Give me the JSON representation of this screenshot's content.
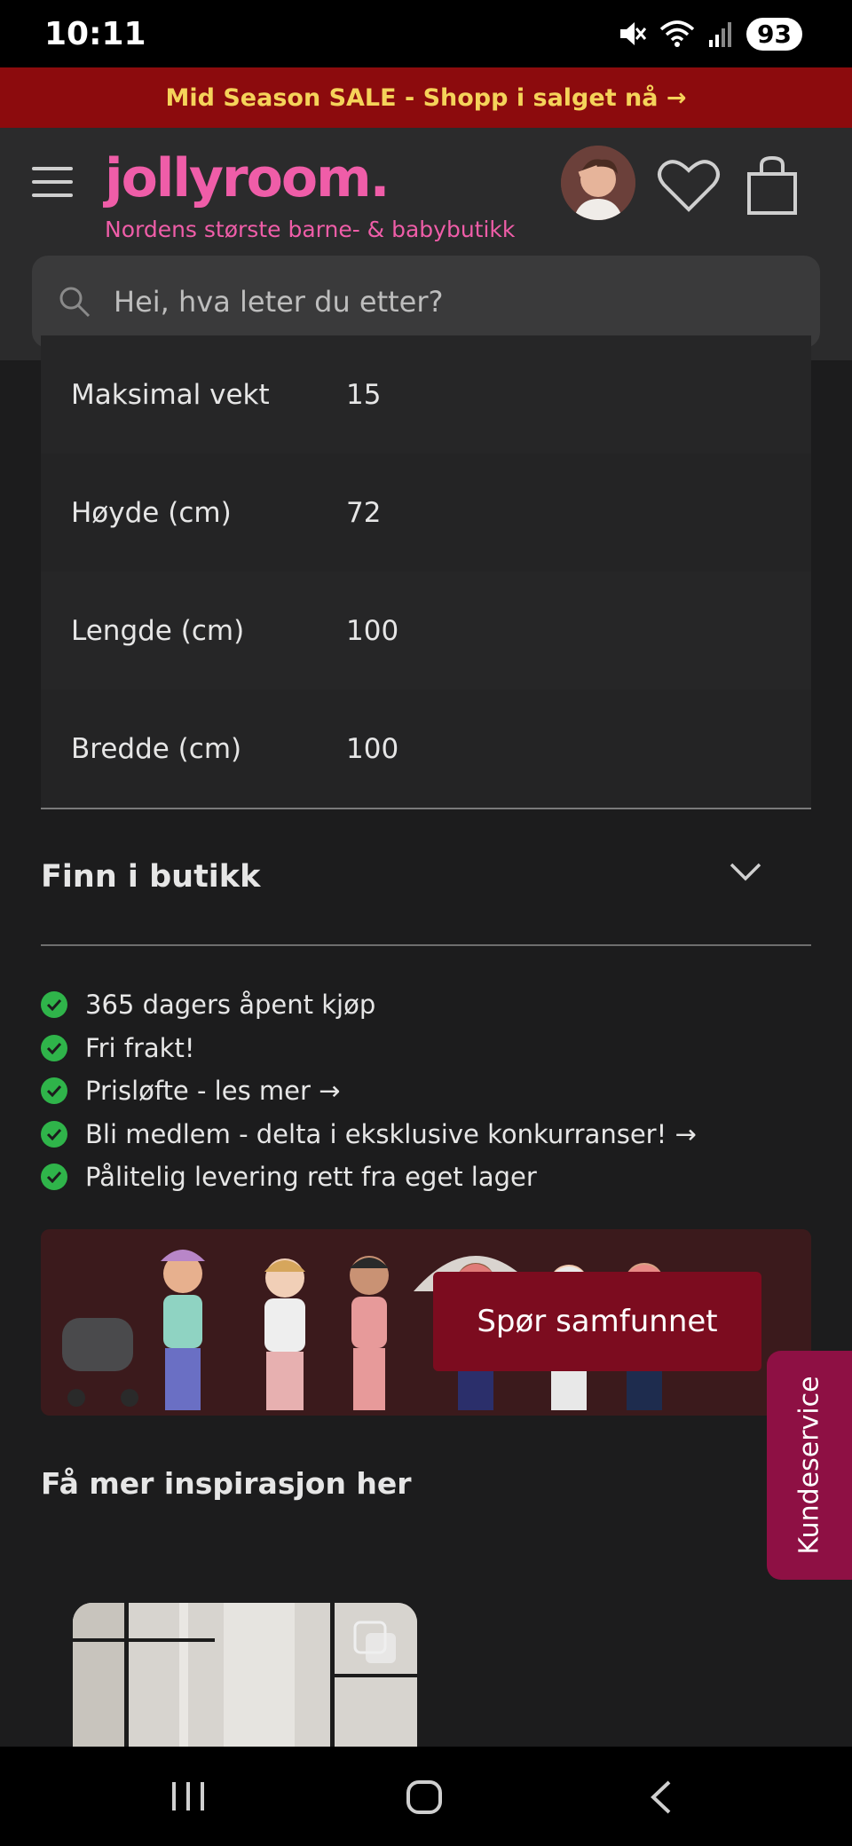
{
  "status_bar": {
    "time": "10:11",
    "battery": "93",
    "icons": [
      "mute-icon",
      "wifi-icon",
      "signal-icon"
    ]
  },
  "promo": {
    "text": "Mid Season SALE - Shopp i salget nå →",
    "background": "#8c0b0d",
    "text_color": "#f5d35a"
  },
  "header": {
    "logo": "jollyroom.",
    "tagline": "Nordens største barne- & babybutikk",
    "brand_color": "#ef5da8",
    "icons": [
      "menu-icon",
      "avatar",
      "heart-icon",
      "bag-icon"
    ]
  },
  "search": {
    "placeholder": "Hei, hva leter du etter?"
  },
  "specs": [
    {
      "label": "Maksimal vekt",
      "value": "15"
    },
    {
      "label": "Høyde (cm)",
      "value": "72"
    },
    {
      "label": "Lengde (cm)",
      "value": "100"
    },
    {
      "label": "Bredde (cm)",
      "value": "100"
    }
  ],
  "accordion": {
    "title": "Finn i butikk"
  },
  "usps": [
    "365 dagers åpent kjøp",
    "Fri frakt!",
    "Prisløfte - les mer →",
    "Bli medlem - delta i eksklusive konkurranser! →",
    "Pålitelig levering rett fra eget lager"
  ],
  "community": {
    "button_label": "Spør samfunnet",
    "button_color": "#7c0c1f"
  },
  "kundeservice": {
    "label": "Kundeservice",
    "color": "#8e1044"
  },
  "inspiration": {
    "title": "Få mer inspirasjon her"
  },
  "nav_bar": {
    "icons": [
      "recent-apps-icon",
      "home-icon",
      "back-icon"
    ]
  }
}
